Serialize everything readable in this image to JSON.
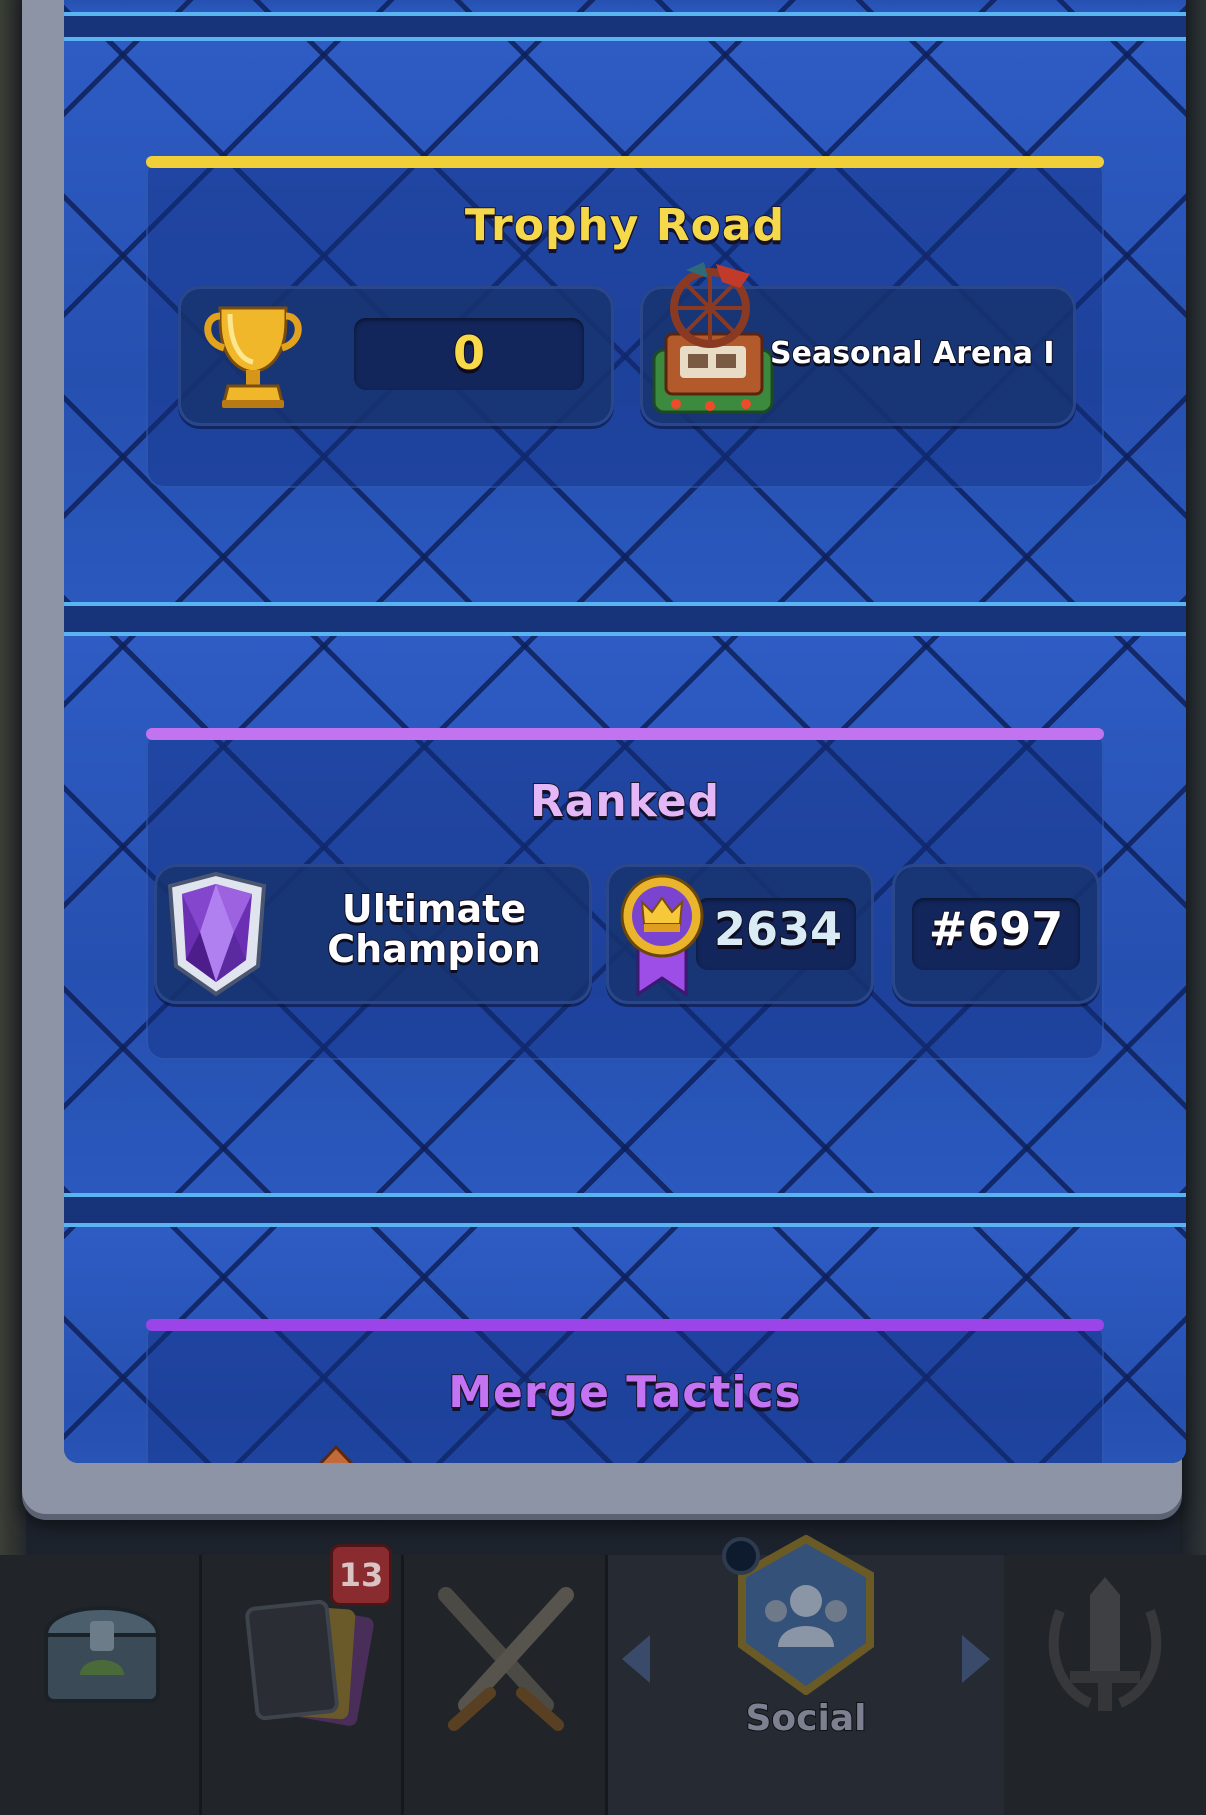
{
  "trophy_road": {
    "title": "Trophy Road",
    "trophies": "0",
    "arena_name": "Seasonal Arena I",
    "bar_color": "#f1cf38",
    "title_color": "#f6d94a"
  },
  "ranked": {
    "title": "Ranked",
    "league_line1": "Ultimate",
    "league_line2": "Champion",
    "rating": "2634",
    "rank": "#697",
    "bar_color": "#c173f0",
    "title_color": "#e4b7f6"
  },
  "merge_tactics": {
    "title": "Merge Tactics",
    "bar_color": "#9b45e8",
    "title_color": "#c473f3"
  },
  "nav": {
    "cards_badge": "13",
    "social_label": "Social",
    "icons": [
      "chest-icon",
      "cards-icon",
      "battle-swords-icon",
      "social-icon",
      "clan-wars-icon"
    ]
  }
}
